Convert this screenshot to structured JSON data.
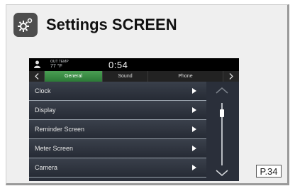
{
  "header": {
    "title": "Settings SCREEN",
    "icon": "settings-gear-icon"
  },
  "screen": {
    "status_bar": {
      "out_temp_label": "OUT TEMP",
      "out_temp_value": "77 °F",
      "time": "0:54"
    },
    "tabs": [
      {
        "label": "General",
        "active": true
      },
      {
        "label": "Sound",
        "active": false
      },
      {
        "label": "Phone",
        "active": false
      }
    ],
    "menu_items": [
      {
        "label": "Clock"
      },
      {
        "label": "Display"
      },
      {
        "label": "Reminder Screen"
      },
      {
        "label": "Meter Screen"
      },
      {
        "label": "Camera"
      }
    ]
  },
  "page_ref": "P.34",
  "colors": {
    "active_tab": "#3a8f45",
    "status_bar": "#000000",
    "list_bg": "#2a2f3a",
    "card_bg": "#efefef"
  }
}
